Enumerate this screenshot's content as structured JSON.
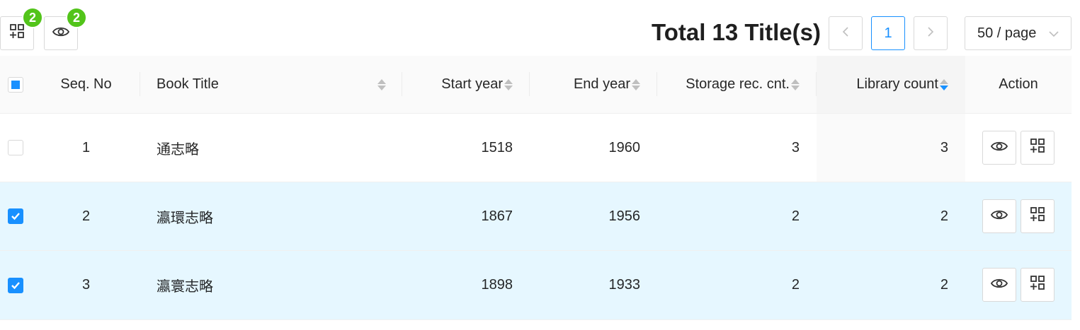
{
  "toolbar": {
    "compare_badge": "2",
    "view_badge": "2"
  },
  "summary": {
    "total_text": "Total 13 Title(s)"
  },
  "pagination": {
    "prev_icon": "chevron-left-icon",
    "current_page": "1",
    "next_icon": "chevron-right-icon",
    "page_size": "50 / page"
  },
  "table": {
    "columns": {
      "seq": "Seq. No",
      "title": "Book Title",
      "start": "Start year",
      "end": "End year",
      "storage": "Storage rec. cnt.",
      "library": "Library count",
      "action": "Action"
    },
    "sorted_column": "library",
    "sort_direction": "descending",
    "rows": [
      {
        "seq": "1",
        "title": "通志略",
        "start": "1518",
        "end": "1960",
        "storage": "3",
        "library": "3",
        "checked": false
      },
      {
        "seq": "2",
        "title": "瀛環志略",
        "start": "1867",
        "end": "1956",
        "storage": "2",
        "library": "2",
        "checked": true
      },
      {
        "seq": "3",
        "title": "瀛寰志略",
        "start": "1898",
        "end": "1933",
        "storage": "2",
        "library": "2",
        "checked": true
      }
    ]
  },
  "colors": {
    "accent": "#1890ff",
    "badge": "#52c41a",
    "selected_row": "#e6f7ff"
  }
}
